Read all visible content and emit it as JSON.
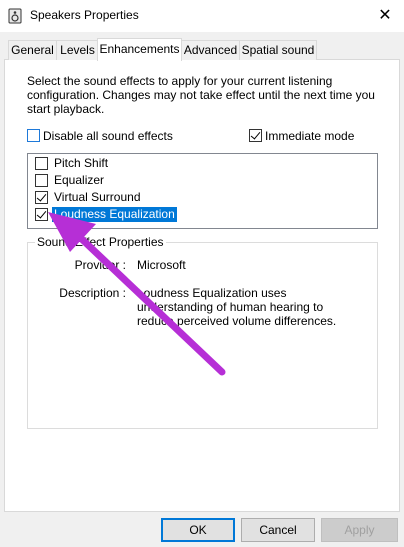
{
  "window": {
    "title": "Speakers Properties",
    "close_glyph": "✕"
  },
  "tabs": [
    {
      "label": "General",
      "active": false
    },
    {
      "label": "Levels",
      "active": false
    },
    {
      "label": "Enhancements",
      "active": true
    },
    {
      "label": "Advanced",
      "active": false
    },
    {
      "label": "Spatial sound",
      "active": false
    }
  ],
  "enhancements": {
    "description": "Select the sound effects to apply for your current listening configuration. Changes may not take effect until the next time you start playback.",
    "disable_all": {
      "label": "Disable all sound effects",
      "checked": false
    },
    "immediate_mode": {
      "label": "Immediate mode",
      "checked": true
    },
    "effects": [
      {
        "label": "Pitch Shift",
        "checked": false,
        "selected": false
      },
      {
        "label": "Equalizer",
        "checked": false,
        "selected": false
      },
      {
        "label": "Virtual Surround",
        "checked": true,
        "selected": false
      },
      {
        "label": "Loudness Equalization",
        "checked": true,
        "selected": true
      }
    ],
    "properties": {
      "group_label": "Sound Effect Properties",
      "provider_label": "Provider :",
      "provider_value": "Microsoft",
      "description_label": "Description :",
      "description_value": "Loudness Equalization uses understanding of human hearing to reduce perceived volume differences."
    }
  },
  "buttons": {
    "ok": "OK",
    "cancel": "Cancel",
    "apply": "Apply"
  },
  "colors": {
    "selection": "#0078d7",
    "annotation_arrow": "#b62fd6"
  }
}
